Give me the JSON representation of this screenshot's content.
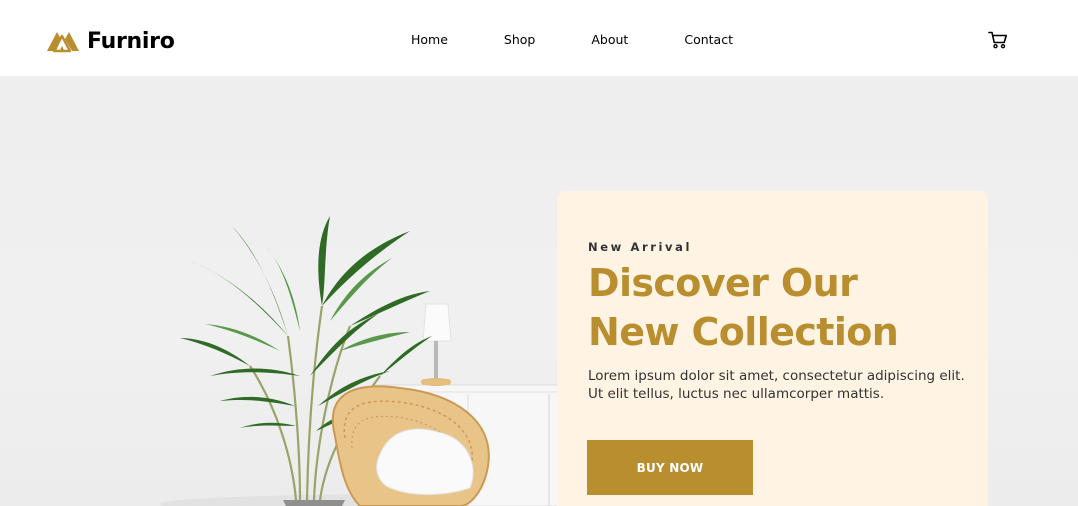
{
  "brand": {
    "name": "Furniro",
    "logo_icon": "furniro-logo-icon",
    "accent_color": "#B88E2F"
  },
  "nav": {
    "items": [
      {
        "label": "Home"
      },
      {
        "label": "Shop"
      },
      {
        "label": "About"
      },
      {
        "label": "Contact"
      }
    ],
    "cart_icon": "cart-icon"
  },
  "hero": {
    "eyebrow": "New Arrival",
    "heading_line1": "Discover Our",
    "heading_line2": "New Collection",
    "description": "Lorem ipsum dolor sit amet, consectetur adipiscing elit. Ut elit tellus, luctus nec ullamcorper mattis.",
    "button_label": "BUY NOW",
    "card_background": "#FFF3E3",
    "image_subject": "potted palm plant, white cabinet with table lamp, rattan chair with cushion"
  }
}
